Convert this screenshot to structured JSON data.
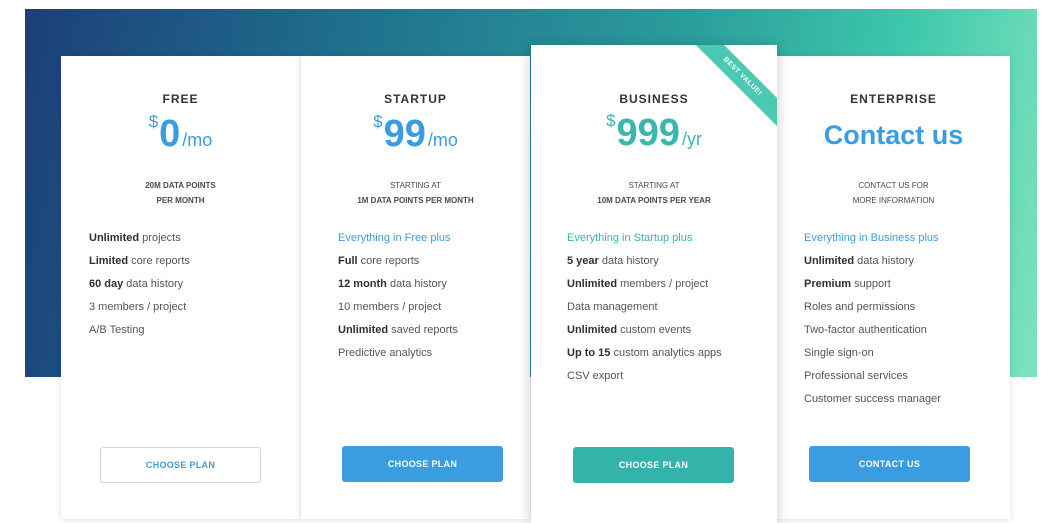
{
  "colors": {
    "accent_blue": "#3a9de2",
    "accent_teal": "#33b4aa",
    "ribbon": "#4dc9b3",
    "gradient_start": "#1c3f78",
    "gradient_end": "#7ee3bd"
  },
  "plans": [
    {
      "name": "FREE",
      "currency": "$",
      "amount": "0",
      "period": "/mo",
      "subtitle_line1": "20M DATA POINTS",
      "subtitle_line2": "PER MONTH",
      "features": [
        {
          "bold": "Unlimited",
          "text": " projects"
        },
        {
          "bold": "Limited",
          "text": " core reports"
        },
        {
          "bold": "60 day",
          "text": " data history"
        },
        {
          "bold": "",
          "text": "3 members / project"
        },
        {
          "bold": "",
          "text": "A/B Testing"
        }
      ],
      "button_label": "CHOOSE PLAN"
    },
    {
      "name": "STARTUP",
      "currency": "$",
      "amount": "99",
      "period": "/mo",
      "subtitle_line1": "STARTING AT",
      "subtitle_line2": "1M DATA POINTS PER MONTH",
      "lead": "Everything in Free plus",
      "features": [
        {
          "bold": "Full",
          "text": " core reports"
        },
        {
          "bold": "12 month",
          "text": " data history"
        },
        {
          "bold": "",
          "text": "10 members / project"
        },
        {
          "bold": "Unlimited",
          "text": " saved reports"
        },
        {
          "bold": "",
          "text": "Predictive analytics"
        }
      ],
      "button_label": "CHOOSE PLAN"
    },
    {
      "name": "BUSINESS",
      "currency": "$",
      "amount": "999",
      "period": "/yr",
      "ribbon": "BEST VALUE!",
      "subtitle_line1": "STARTING AT",
      "subtitle_line2": "10M DATA POINTS PER YEAR",
      "lead": "Everything in Startup plus",
      "features": [
        {
          "bold": "5 year",
          "text": " data history"
        },
        {
          "bold": "Unlimited",
          "text": " members / project"
        },
        {
          "bold": "",
          "text": "Data management"
        },
        {
          "bold": "Unlimited",
          "text": " custom events"
        },
        {
          "bold": "Up to 15",
          "text": " custom analytics apps"
        },
        {
          "bold": "",
          "text": "CSV export"
        }
      ],
      "button_label": "CHOOSE PLAN"
    },
    {
      "name": "ENTERPRISE",
      "price_text": "Contact us",
      "subtitle_line1": "CONTACT US FOR",
      "subtitle_line2": "MORE INFORMATION",
      "lead": "Everything in Business plus",
      "features": [
        {
          "bold": "Unlimited",
          "text": " data history"
        },
        {
          "bold": "Premium",
          "text": " support"
        },
        {
          "bold": "",
          "text": "Roles and permissions"
        },
        {
          "bold": "",
          "text": "Two-factor authentication"
        },
        {
          "bold": "",
          "text": "Single sign-on"
        },
        {
          "bold": "",
          "text": "Professional services"
        },
        {
          "bold": "",
          "text": "Customer success manager"
        }
      ],
      "button_label": "CONTACT US"
    }
  ]
}
